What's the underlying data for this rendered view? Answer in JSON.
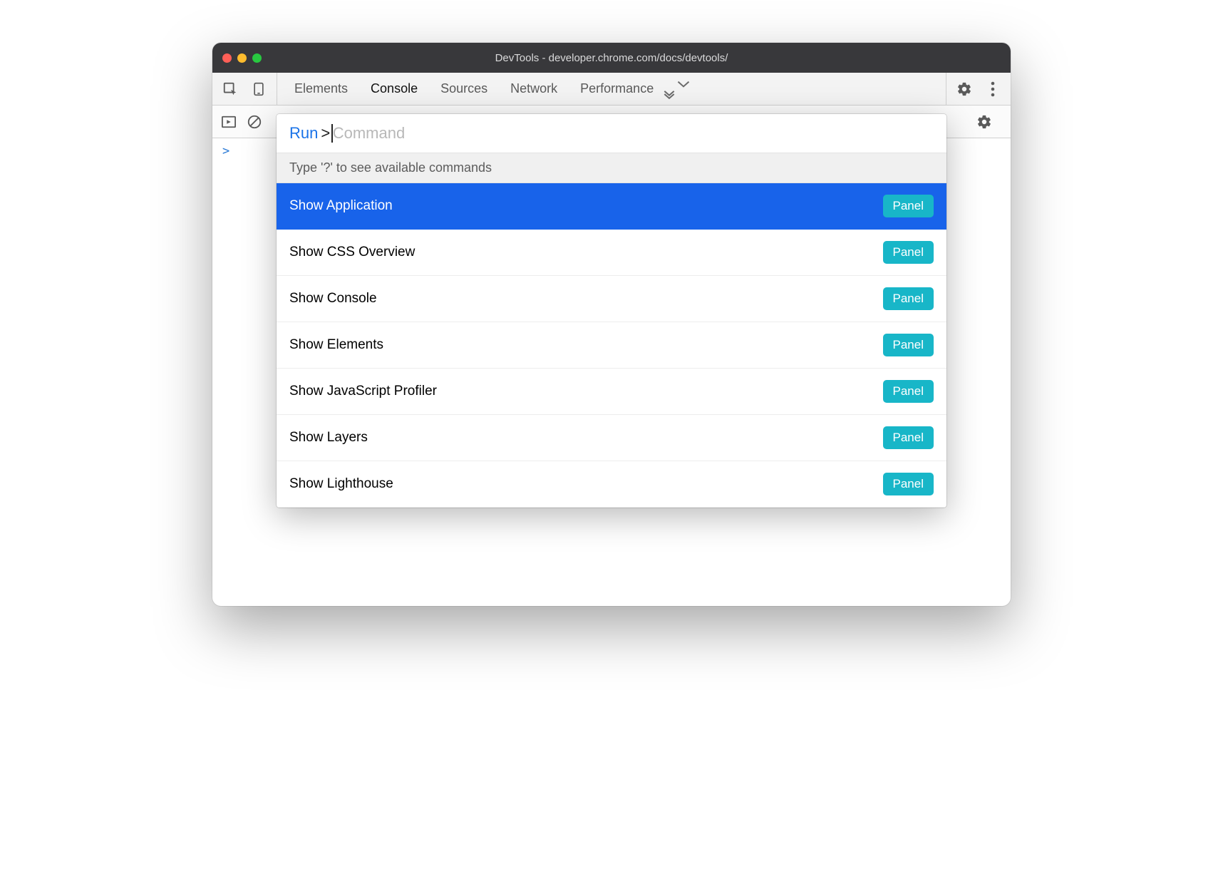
{
  "window": {
    "title": "DevTools - developer.chrome.com/docs/devtools/"
  },
  "tabbar": {
    "tabs": [
      {
        "label": "Elements",
        "active": false
      },
      {
        "label": "Console",
        "active": true
      },
      {
        "label": "Sources",
        "active": false
      },
      {
        "label": "Network",
        "active": false
      },
      {
        "label": "Performance",
        "active": false
      }
    ]
  },
  "console": {
    "prompt": ">"
  },
  "commandMenu": {
    "prefix": "Run",
    "symbol": ">",
    "placeholder": "Command",
    "hint": "Type '?' to see available commands",
    "items": [
      {
        "label": "Show Application",
        "badge": "Panel",
        "selected": true
      },
      {
        "label": "Show CSS Overview",
        "badge": "Panel",
        "selected": false
      },
      {
        "label": "Show Console",
        "badge": "Panel",
        "selected": false
      },
      {
        "label": "Show Elements",
        "badge": "Panel",
        "selected": false
      },
      {
        "label": "Show JavaScript Profiler",
        "badge": "Panel",
        "selected": false
      },
      {
        "label": "Show Layers",
        "badge": "Panel",
        "selected": false
      },
      {
        "label": "Show Lighthouse",
        "badge": "Panel",
        "selected": false
      }
    ]
  }
}
